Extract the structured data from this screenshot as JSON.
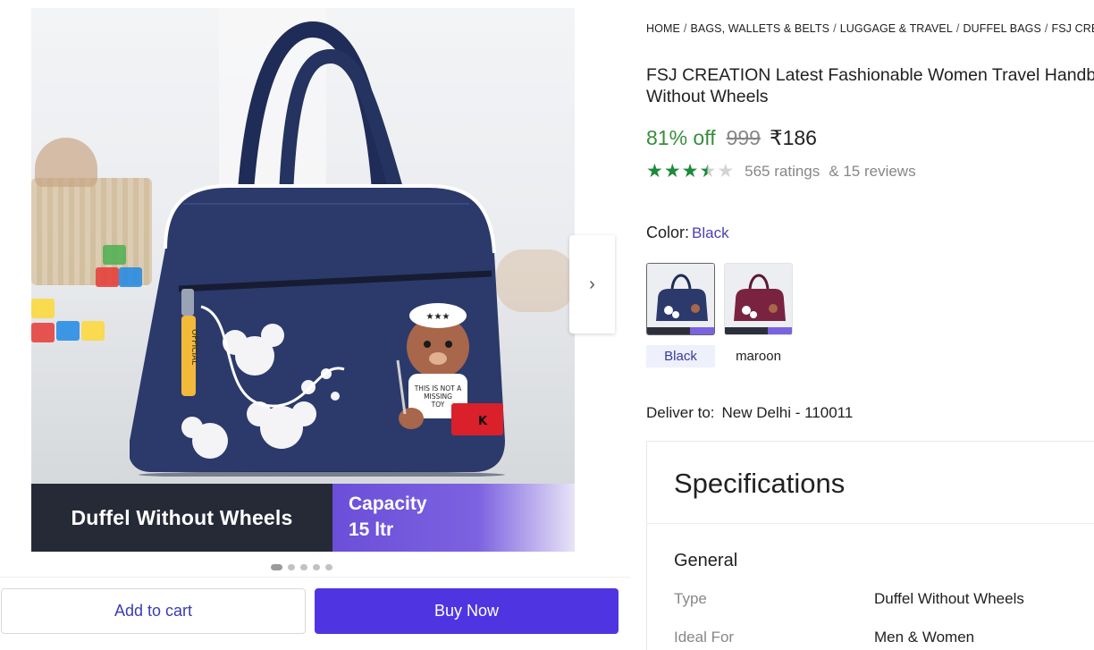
{
  "gallery": {
    "caption_left": "Duffel Without Wheels",
    "caption_right_line1": "Capacity",
    "caption_right_line2": "15 ltr",
    "bag_tag_text": "THIS IS NOT A MISSING TOY",
    "book_letter": "K",
    "hat_stars": "★★★",
    "dots_count": 5,
    "active_dot": 1
  },
  "actions": {
    "add_to_cart": "Add to cart",
    "buy_now": "Buy Now"
  },
  "breadcrumb": [
    "HOME",
    "BAGS, WALLETS & BELTS",
    "LUGGAGE & TRAVEL",
    "DUFFEL BAGS",
    "FSJ CREATION"
  ],
  "product": {
    "title_line1": "FSJ CREATION Latest Fashionable Women Travel Handbag",
    "title_line2": "Without Wheels",
    "discount": "81% off",
    "mrp": "999",
    "price": "₹186",
    "rating_stars": 3.5,
    "ratings_text": "565 ratings",
    "reviews_text": "& 15 reviews"
  },
  "color": {
    "label": "Color:",
    "selected": "Black",
    "options": [
      "Black",
      "maroon"
    ]
  },
  "delivery": {
    "label": "Deliver to:",
    "location": "New Delhi - 110011"
  },
  "specifications": {
    "heading": "Specifications",
    "section": "General",
    "rows": [
      {
        "key": "Type",
        "value": "Duffel Without Wheels"
      },
      {
        "key": "Ideal For",
        "value": "Men & Women"
      }
    ]
  },
  "colors": {
    "brand_button": "#4f35e1",
    "discount_green": "#388e3c",
    "star_green": "#1d8a3a",
    "bag_navy": "#2b3a6b",
    "bag_maroon": "#7a2340"
  }
}
